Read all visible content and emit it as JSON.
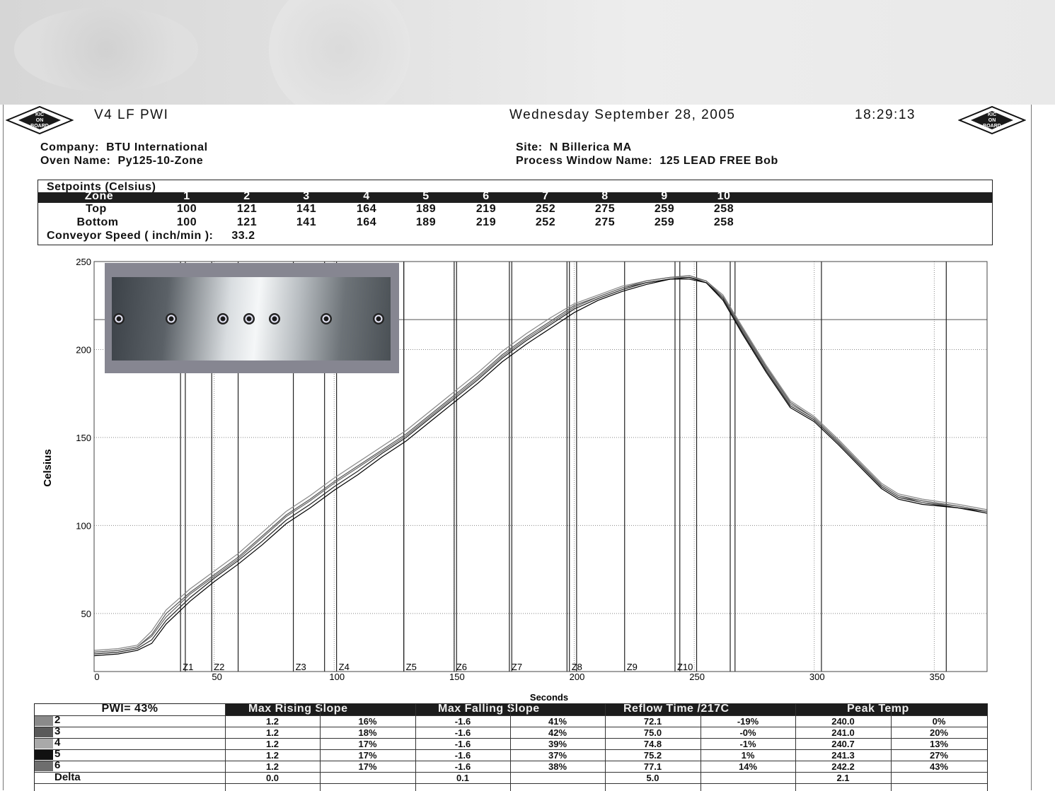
{
  "header": {
    "title": "V4 LF PWI",
    "date": "Wednesday September 28, 2005",
    "time": "18:29:13",
    "logo_text": [
      "KIC",
      "ON",
      "BOARD"
    ]
  },
  "info": {
    "company_label": "Company:",
    "company": "BTU International",
    "oven_label": "Oven Name:",
    "oven": "Py125-10-Zone",
    "site_label": "Site:",
    "site": "N Billerica MA",
    "window_label": "Process Window Name:",
    "window": "125 LEAD FREE Bob"
  },
  "setpoints": {
    "title": "Setpoints (Celsius)",
    "zone_label": "Zone",
    "zones": [
      "1",
      "2",
      "3",
      "4",
      "5",
      "6",
      "7",
      "8",
      "9",
      "10"
    ],
    "top_label": "Top",
    "top": [
      "100",
      "121",
      "141",
      "164",
      "189",
      "219",
      "252",
      "275",
      "259",
      "258"
    ],
    "bottom_label": "Bottom",
    "bottom": [
      "100",
      "121",
      "141",
      "164",
      "189",
      "219",
      "252",
      "275",
      "259",
      "258"
    ],
    "conveyor_label": "Conveyor Speed ( inch/min ):",
    "conveyor": "33.2"
  },
  "chart_data": {
    "type": "line",
    "xlabel": "Seconds",
    "ylabel": "Celsius",
    "xlim": [
      0,
      372
    ],
    "ylim": [
      17,
      250
    ],
    "xticks": [
      0,
      50,
      100,
      150,
      200,
      250,
      300,
      350
    ],
    "yticks": [
      50,
      100,
      150,
      200,
      250
    ],
    "grid": true,
    "zone_markers": [
      {
        "label": "Z1",
        "x": [
          36,
          38
        ]
      },
      {
        "label": "Z2",
        "x": [
          49,
          60
        ]
      },
      {
        "label": "Z3",
        "x": [
          83,
          96
        ]
      },
      {
        "label": "Z4",
        "x": [
          101,
          129
        ]
      },
      {
        "label": "Z5",
        "x": [
          129,
          151
        ]
      },
      {
        "label": "Z6",
        "x": [
          150,
          174
        ]
      },
      {
        "label": "Z7",
        "x": [
          173,
          197
        ]
      },
      {
        "label": "Z8",
        "x": [
          198,
          201
        ]
      },
      {
        "label": "Z9",
        "x": [
          221,
          244
        ]
      },
      {
        "label": "Z10",
        "x": [
          242,
          251
        ]
      },
      {
        "label": "",
        "x": [
          265,
          267
        ]
      },
      {
        "label": "",
        "x": [
          303,
          355
        ]
      }
    ],
    "hgrid_solid": [
      217
    ],
    "series": [
      {
        "color": "#555555",
        "values": [
          [
            0,
            28
          ],
          [
            10,
            29
          ],
          [
            18,
            31
          ],
          [
            24,
            38
          ],
          [
            30,
            50
          ],
          [
            40,
            62
          ],
          [
            50,
            72
          ],
          [
            60,
            82
          ],
          [
            70,
            94
          ],
          [
            80,
            106
          ],
          [
            90,
            115
          ],
          [
            100,
            125
          ],
          [
            110,
            134
          ],
          [
            120,
            143
          ],
          [
            130,
            152
          ],
          [
            140,
            163
          ],
          [
            150,
            174
          ],
          [
            160,
            185
          ],
          [
            170,
            197
          ],
          [
            180,
            207
          ],
          [
            190,
            216
          ],
          [
            200,
            225
          ],
          [
            210,
            230
          ],
          [
            220,
            235
          ],
          [
            230,
            238
          ],
          [
            240,
            240
          ],
          [
            248,
            240
          ],
          [
            255,
            238
          ],
          [
            262,
            230
          ],
          [
            270,
            212
          ],
          [
            280,
            190
          ],
          [
            290,
            170
          ],
          [
            300,
            161
          ],
          [
            310,
            148
          ],
          [
            320,
            134
          ],
          [
            328,
            123
          ],
          [
            335,
            117
          ],
          [
            345,
            114
          ],
          [
            360,
            111
          ],
          [
            372,
            108
          ]
        ]
      },
      {
        "color": "#222222",
        "values": [
          [
            0,
            27
          ],
          [
            10,
            28
          ],
          [
            18,
            30
          ],
          [
            24,
            35
          ],
          [
            30,
            46
          ],
          [
            40,
            59
          ],
          [
            50,
            70
          ],
          [
            60,
            80
          ],
          [
            70,
            91
          ],
          [
            80,
            103
          ],
          [
            90,
            112
          ],
          [
            100,
            122
          ],
          [
            110,
            131
          ],
          [
            120,
            141
          ],
          [
            130,
            150
          ],
          [
            140,
            161
          ],
          [
            150,
            172
          ],
          [
            160,
            183
          ],
          [
            170,
            195
          ],
          [
            180,
            205
          ],
          [
            190,
            214
          ],
          [
            200,
            223
          ],
          [
            210,
            229
          ],
          [
            220,
            234
          ],
          [
            230,
            238
          ],
          [
            240,
            240
          ],
          [
            248,
            240
          ],
          [
            255,
            238
          ],
          [
            262,
            229
          ],
          [
            270,
            210
          ],
          [
            280,
            188
          ],
          [
            290,
            168
          ],
          [
            300,
            160
          ],
          [
            310,
            147
          ],
          [
            320,
            133
          ],
          [
            328,
            122
          ],
          [
            335,
            116
          ],
          [
            345,
            113
          ],
          [
            360,
            110
          ],
          [
            372,
            108
          ]
        ]
      },
      {
        "color": "#888888",
        "values": [
          [
            0,
            29
          ],
          [
            10,
            30
          ],
          [
            18,
            32
          ],
          [
            24,
            40
          ],
          [
            30,
            52
          ],
          [
            40,
            64
          ],
          [
            50,
            74
          ],
          [
            60,
            84
          ],
          [
            70,
            96
          ],
          [
            80,
            108
          ],
          [
            90,
            117
          ],
          [
            100,
            127
          ],
          [
            110,
            136
          ],
          [
            120,
            145
          ],
          [
            130,
            154
          ],
          [
            140,
            165
          ],
          [
            150,
            176
          ],
          [
            160,
            187
          ],
          [
            170,
            199
          ],
          [
            180,
            209
          ],
          [
            190,
            218
          ],
          [
            200,
            226
          ],
          [
            210,
            231
          ],
          [
            220,
            236
          ],
          [
            230,
            239
          ],
          [
            240,
            241
          ],
          [
            248,
            241
          ],
          [
            255,
            239
          ],
          [
            262,
            231
          ],
          [
            270,
            213
          ],
          [
            280,
            191
          ],
          [
            290,
            171
          ],
          [
            300,
            162
          ],
          [
            310,
            149
          ],
          [
            320,
            135
          ],
          [
            328,
            124
          ],
          [
            335,
            118
          ],
          [
            345,
            115
          ],
          [
            360,
            112
          ],
          [
            372,
            109
          ]
        ]
      },
      {
        "color": "#000000",
        "values": [
          [
            0,
            26
          ],
          [
            10,
            27
          ],
          [
            18,
            29
          ],
          [
            24,
            33
          ],
          [
            30,
            44
          ],
          [
            40,
            57
          ],
          [
            50,
            68
          ],
          [
            60,
            78
          ],
          [
            70,
            89
          ],
          [
            80,
            101
          ],
          [
            90,
            110
          ],
          [
            100,
            120
          ],
          [
            110,
            129
          ],
          [
            120,
            139
          ],
          [
            130,
            148
          ],
          [
            140,
            159
          ],
          [
            150,
            170
          ],
          [
            160,
            181
          ],
          [
            170,
            193
          ],
          [
            180,
            203
          ],
          [
            190,
            212
          ],
          [
            200,
            221
          ],
          [
            210,
            228
          ],
          [
            220,
            233
          ],
          [
            230,
            237
          ],
          [
            240,
            240
          ],
          [
            248,
            241
          ],
          [
            255,
            238
          ],
          [
            262,
            228
          ],
          [
            270,
            209
          ],
          [
            280,
            187
          ],
          [
            290,
            167
          ],
          [
            300,
            159
          ],
          [
            310,
            146
          ],
          [
            320,
            132
          ],
          [
            328,
            121
          ],
          [
            335,
            115
          ],
          [
            345,
            112
          ],
          [
            360,
            110
          ],
          [
            372,
            107
          ]
        ]
      },
      {
        "color": "#666666",
        "values": [
          [
            0,
            28
          ],
          [
            10,
            29
          ],
          [
            18,
            31
          ],
          [
            24,
            37
          ],
          [
            30,
            48
          ],
          [
            40,
            61
          ],
          [
            50,
            71
          ],
          [
            60,
            81
          ],
          [
            70,
            93
          ],
          [
            80,
            105
          ],
          [
            90,
            114
          ],
          [
            100,
            124
          ],
          [
            110,
            133
          ],
          [
            120,
            142
          ],
          [
            130,
            151
          ],
          [
            140,
            162
          ],
          [
            150,
            173
          ],
          [
            160,
            184
          ],
          [
            170,
            196
          ],
          [
            180,
            206
          ],
          [
            190,
            215
          ],
          [
            200,
            224
          ],
          [
            210,
            230
          ],
          [
            220,
            235
          ],
          [
            230,
            239
          ],
          [
            240,
            241
          ],
          [
            248,
            242
          ],
          [
            255,
            239
          ],
          [
            262,
            230
          ],
          [
            270,
            211
          ],
          [
            280,
            189
          ],
          [
            290,
            169
          ],
          [
            300,
            161
          ],
          [
            310,
            148
          ],
          [
            320,
            134
          ],
          [
            328,
            123
          ],
          [
            335,
            117
          ],
          [
            345,
            113
          ],
          [
            360,
            111
          ],
          [
            372,
            108
          ]
        ]
      }
    ]
  },
  "pwi_table": {
    "pwi_label": "PWI= 43%",
    "headers": [
      "Max Rising Slope",
      "Max Falling Slope",
      "Reflow Time /217C",
      "Peak Temp"
    ],
    "rows": [
      {
        "id": "2",
        "swatch": "#8a8a8a",
        "cells": [
          "1.2",
          "16%",
          "-1.6",
          "41%",
          "72.1",
          "-19%",
          "240.0",
          "0%"
        ]
      },
      {
        "id": "3",
        "swatch": "#5a5a5a",
        "cells": [
          "1.2",
          "18%",
          "-1.6",
          "42%",
          "75.0",
          "-0%",
          "241.0",
          "20%"
        ]
      },
      {
        "id": "4",
        "swatch": "#a9a9a9",
        "cells": [
          "1.2",
          "17%",
          "-1.6",
          "39%",
          "74.8",
          "-1%",
          "240.7",
          "13%"
        ]
      },
      {
        "id": "5",
        "swatch": "#111111",
        "cells": [
          "1.2",
          "17%",
          "-1.6",
          "37%",
          "75.2",
          "1%",
          "241.3",
          "27%"
        ]
      },
      {
        "id": "6",
        "swatch": "#6e6e6e",
        "cells": [
          "1.2",
          "17%",
          "-1.6",
          "38%",
          "77.1",
          "14%",
          "242.2",
          "43%"
        ]
      }
    ],
    "delta_label": "Delta",
    "delta": [
      "0.0",
      "0.1",
      "5.0",
      "2.1"
    ]
  }
}
